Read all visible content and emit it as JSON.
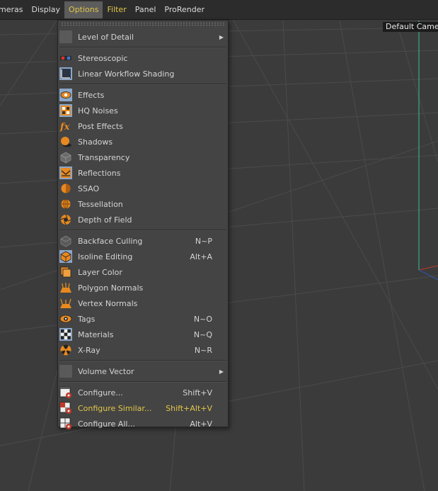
{
  "menubar": {
    "items": [
      {
        "label": "meras"
      },
      {
        "label": "Display"
      },
      {
        "label": "Options"
      },
      {
        "label": "Filter"
      },
      {
        "label": "Panel"
      },
      {
        "label": "ProRender"
      }
    ]
  },
  "viewport": {
    "camera_label": "Default Camera"
  },
  "options_menu": {
    "level_of_detail": "Level of Detail",
    "stereoscopic": "Stereoscopic",
    "linear_workflow": "Linear Workflow Shading",
    "effects": "Effects",
    "hq_noises": "HQ Noises",
    "post_effects": "Post Effects",
    "shadows": "Shadows",
    "transparency": "Transparency",
    "reflections": "Reflections",
    "ssao": "SSAO",
    "tessellation": "Tessellation",
    "depth_of_field": "Depth of Field",
    "backface_culling": "Backface Culling",
    "backface_culling_sc": "N~P",
    "isoline_editing": "Isoline Editing",
    "isoline_editing_sc": "Alt+A",
    "layer_color": "Layer Color",
    "polygon_normals": "Polygon Normals",
    "vertex_normals": "Vertex Normals",
    "tags": "Tags",
    "tags_sc": "N~O",
    "materials": "Materials",
    "materials_sc": "N~Q",
    "xray": "X-Ray",
    "xray_sc": "N~R",
    "volume_vector": "Volume Vector",
    "configure": "Configure...",
    "configure_sc": "Shift+V",
    "configure_similar": "Configure Similar...",
    "configure_similar_sc": "Shift+Alt+V",
    "configure_all": "Configure All...",
    "configure_all_sc": "Alt+V"
  },
  "colors": {
    "accent_yellow": "#e0c64a",
    "icon_orange": "#e8891f",
    "active_icon_bg": "#8aa6c9"
  }
}
